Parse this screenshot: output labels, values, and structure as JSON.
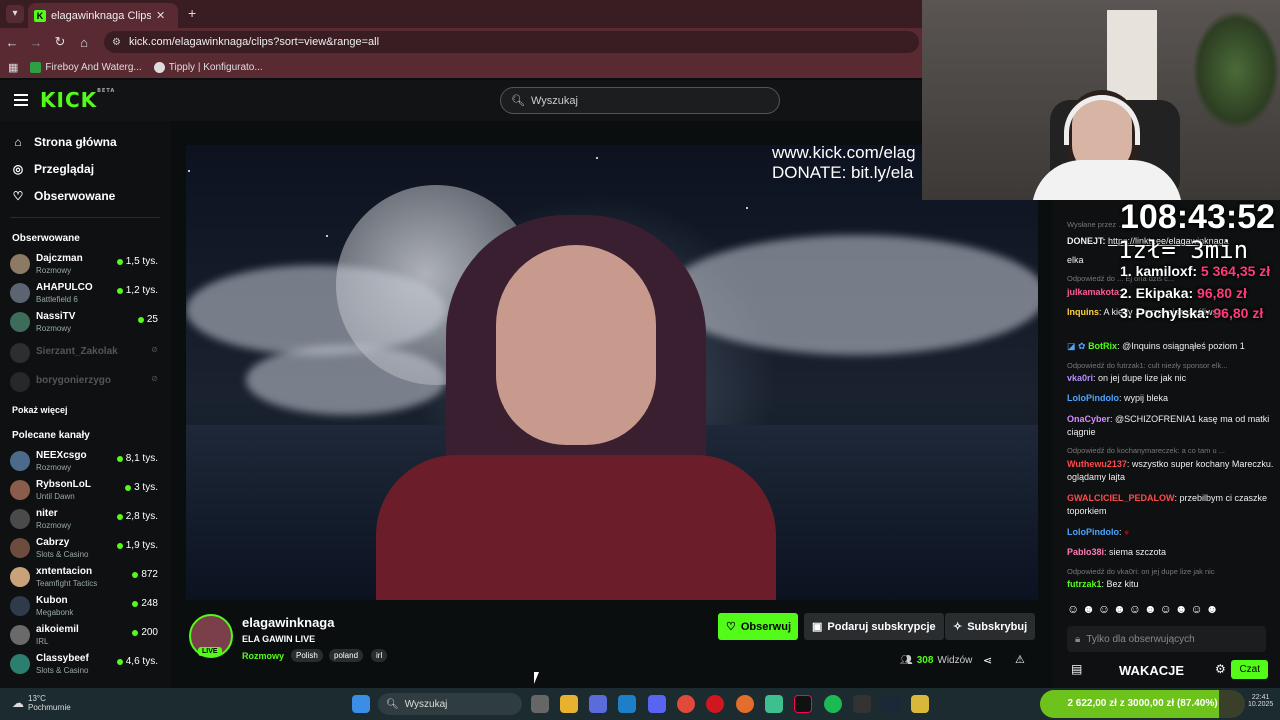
{
  "browser": {
    "tab_title": "elagawinknaga Clips - Watc",
    "url": "kick.com/elagawinknaga/clips?sort=view&range=all",
    "bookmarks": [
      "Fireboy And Waterg...",
      "Tipply | Konfigurato..."
    ]
  },
  "header": {
    "logo": "KICK",
    "logo_beta": "BETA",
    "search_placeholder": "Wyszukaj"
  },
  "sidebar": {
    "nav": [
      "Strona główna",
      "Przeglądaj",
      "Obserwowane"
    ],
    "followed_title": "Obserwowane",
    "followed": [
      {
        "name": "Dajczman",
        "category": "Rozmowy",
        "viewers": "1,5 tys.",
        "avatar": "#8c7a64"
      },
      {
        "name": "AHAPULCO",
        "category": "Battlefield 6",
        "viewers": "1,2 tys.",
        "avatar": "#5b6470"
      },
      {
        "name": "NassiTV",
        "category": "Rozmowy",
        "viewers": "25",
        "avatar": "#3d6c5a"
      },
      {
        "name": "Sierzant_Zakolak",
        "category": "",
        "viewers": "",
        "avatar": "#666"
      },
      {
        "name": "borygonierzygo",
        "category": "",
        "viewers": "",
        "avatar": "#555"
      }
    ],
    "show_more": "Pokaż więcej",
    "recommended_title": "Polecane kanały",
    "recommended": [
      {
        "name": "NEEXcsgo",
        "category": "Rozmowy",
        "viewers": "8,1 tys.",
        "avatar": "#4c6b8a"
      },
      {
        "name": "RybsonLoL",
        "category": "Until Dawn",
        "viewers": "3 tys.",
        "avatar": "#8a5c4c"
      },
      {
        "name": "niter",
        "category": "Rozmowy",
        "viewers": "2,8 tys.",
        "avatar": "#4a4a4a"
      },
      {
        "name": "Cabrzy",
        "category": "Slots & Casino",
        "viewers": "1,9 tys.",
        "avatar": "#6b4c3d"
      },
      {
        "name": "xntentacion",
        "category": "Teamfight Tactics",
        "viewers": "872",
        "avatar": "#c9a27a"
      },
      {
        "name": "Kubon",
        "category": "Megabonk",
        "viewers": "248",
        "avatar": "#2f3a4a"
      },
      {
        "name": "aikoiemil",
        "category": "IRL",
        "viewers": "200",
        "avatar": "#6a6a6a"
      },
      {
        "name": "Classybeef",
        "category": "Slots & Casino",
        "viewers": "4,6 tys.",
        "avatar": "#2c7f6f"
      }
    ]
  },
  "video": {
    "overlay_line1": "www.kick.com/elag",
    "overlay_line2": "DONATE: bit.ly/ela"
  },
  "channel": {
    "name": "elagawinknaga",
    "live": "LIVE",
    "title": "ELA GAWIN LIVE",
    "category": "Rozmowy",
    "tags": [
      "Polish",
      "poland",
      "irl"
    ],
    "follow": "Obserwuj",
    "gift": "Podaruj subskrypcje",
    "subscribe": "Subskrybuj",
    "viewers": "308",
    "viewers_label": "Widzów"
  },
  "chat": {
    "messages": [
      {
        "kind": "reply",
        "text": "Wysłane przez ..."
      },
      {
        "kind": "msg",
        "user": "DONEJT:",
        "color": "#fff",
        "text": "https://linktr.ee/elagawinknaga"
      },
      {
        "kind": "msg",
        "user": "",
        "color": "#fff",
        "text": "elka"
      },
      {
        "kind": "reply",
        "text": "Odpowiedź do ... Ej ona dziś c..."
      },
      {
        "kind": "msg",
        "user": "julkamakota",
        "color": "#ff5a9a",
        "text": ""
      },
      {
        "kind": "msg",
        "user": "Inquins",
        "color": "#ffd23f",
        "text": "A kiedy ... przenajszczęśliwszy"
      },
      {
        "kind": "msg",
        "user": "BotRix",
        "color": "#53fc18",
        "text": "@Inquins osiągnąłeś poziom 1"
      },
      {
        "kind": "reply",
        "text": "Odpowiedź do futrzak1: cult niezły sponsor elk..."
      },
      {
        "kind": "msg",
        "user": "vka0ri",
        "color": "#b58cff",
        "text": "on jej dupe lize jak nic"
      },
      {
        "kind": "msg",
        "user": "LoloPindolo",
        "color": "#4fa3ff",
        "text": "wypij bleka"
      },
      {
        "kind": "msg",
        "user": "OnaCyber",
        "color": "#d68cff",
        "text": "@SCHIZOFRENIA1 kasę ma od matki ciągnie"
      },
      {
        "kind": "reply",
        "text": "Odpowiedź do kochanymareczek: a co tam u ..."
      },
      {
        "kind": "msg",
        "user": "Wuthewu2137",
        "color": "#ff4a4a",
        "text": "wszystko super kochany Mareczku. oglądamy lajta"
      },
      {
        "kind": "msg",
        "user": "GWALCICIEL_PEDALOW",
        "color": "#ff4a4a",
        "text": "przebilbym ci czaszke toporkiem"
      },
      {
        "kind": "msg",
        "user": "LoloPindolo",
        "color": "#4fa3ff",
        "text": ""
      },
      {
        "kind": "msg",
        "user": "Pablo38i",
        "color": "#ff7ab8",
        "text": "siema szczota"
      },
      {
        "kind": "reply",
        "text": "Odpowiedź do vka0ri: on jej dupe lize jak nic"
      },
      {
        "kind": "msg",
        "user": "futrzak1",
        "color": "#53fc18",
        "text": "Bez kitu"
      }
    ],
    "input_placeholder": "Tylko dla obserwujących",
    "emote_label": "WAKACJE",
    "send": "Czat"
  },
  "stream_overlay": {
    "timer": "108:43:52",
    "line": "1zł= 3min",
    "top1": "1. kamiloxf:",
    "top1_amount": "5 364,35 zł",
    "top2": "2. Ekipaka:",
    "top2_amount": "96,80 zł",
    "top3": "3. Pochylska:",
    "top3_amount": "96,80 zł"
  },
  "taskbar": {
    "weather_temp": "13°C",
    "weather_desc": "Pochmurnie",
    "search": "Wyszukaj",
    "goal": "2 622,00 zł z 3000,00 zł (87.40%)",
    "goal_fraction": 0.874,
    "time": "22:41",
    "date": "10.2025"
  }
}
